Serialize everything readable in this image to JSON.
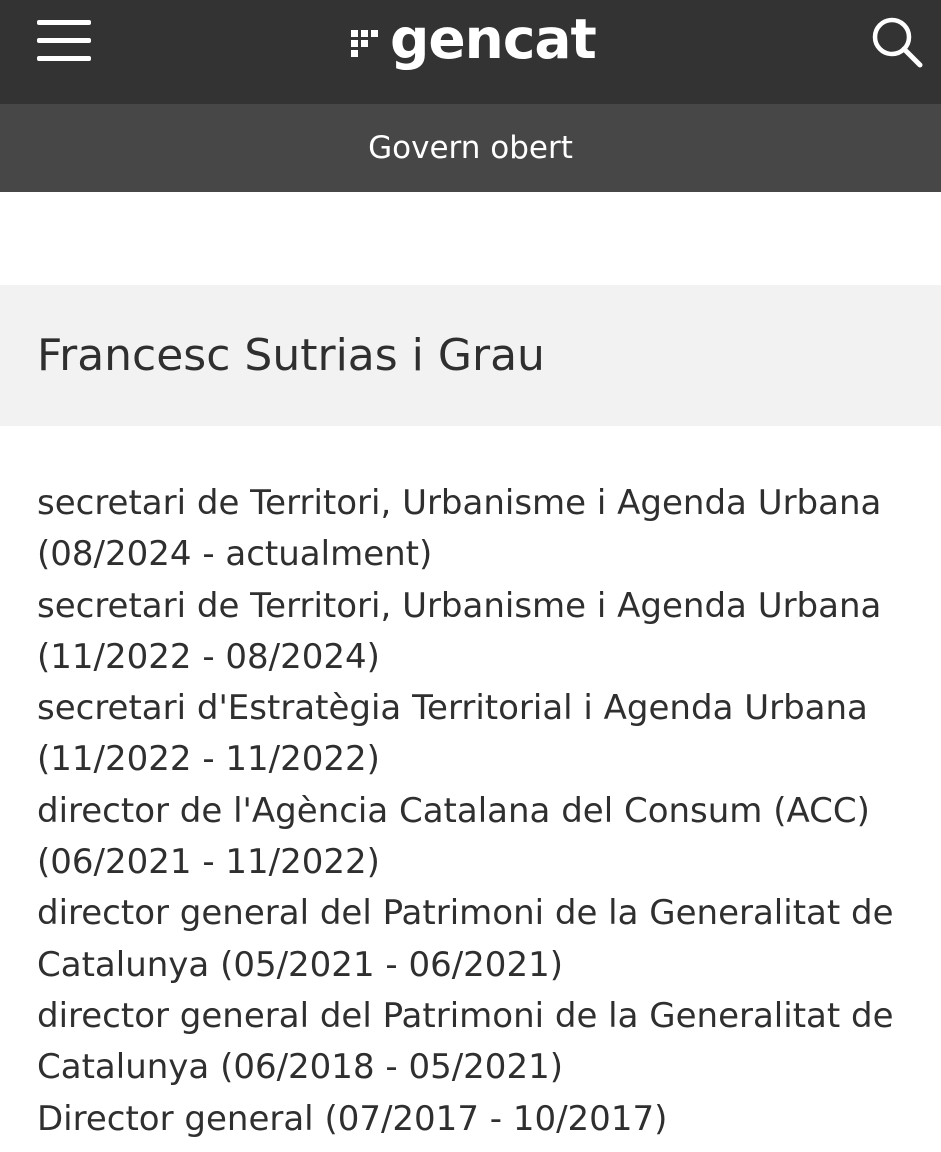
{
  "header": {
    "brand": "gencat",
    "menu_icon": "hamburger-menu-icon",
    "search_icon": "search-icon",
    "section_title": "Govern obert"
  },
  "person": {
    "name": "Francesc Sutrias i Grau"
  },
  "positions": [
    {
      "role": "secretari de Territori, Urbanisme i Agenda Urbana",
      "period": "(08/2024 - actualment)"
    },
    {
      "role": "secretari de Territori, Urbanisme i Agenda Urbana",
      "period": "(11/2022 - 08/2024)"
    },
    {
      "role": "secretari d'Estratègia Territorial i Agenda Urbana",
      "period": "(11/2022 - 11/2022)"
    },
    {
      "role": "director de l'Agència Catalana del Consum (ACC)",
      "period": "(06/2021 - 11/2022)"
    },
    {
      "role": "director general del Patrimoni de la Generalitat de Catalunya",
      "period": "(05/2021 - 06/2021)"
    },
    {
      "role": "director general del Patrimoni de la Generalitat de Catalunya",
      "period": "(06/2018 - 05/2021)"
    },
    {
      "role": "Director general",
      "period": "(07/2017 - 10/2017)"
    }
  ]
}
